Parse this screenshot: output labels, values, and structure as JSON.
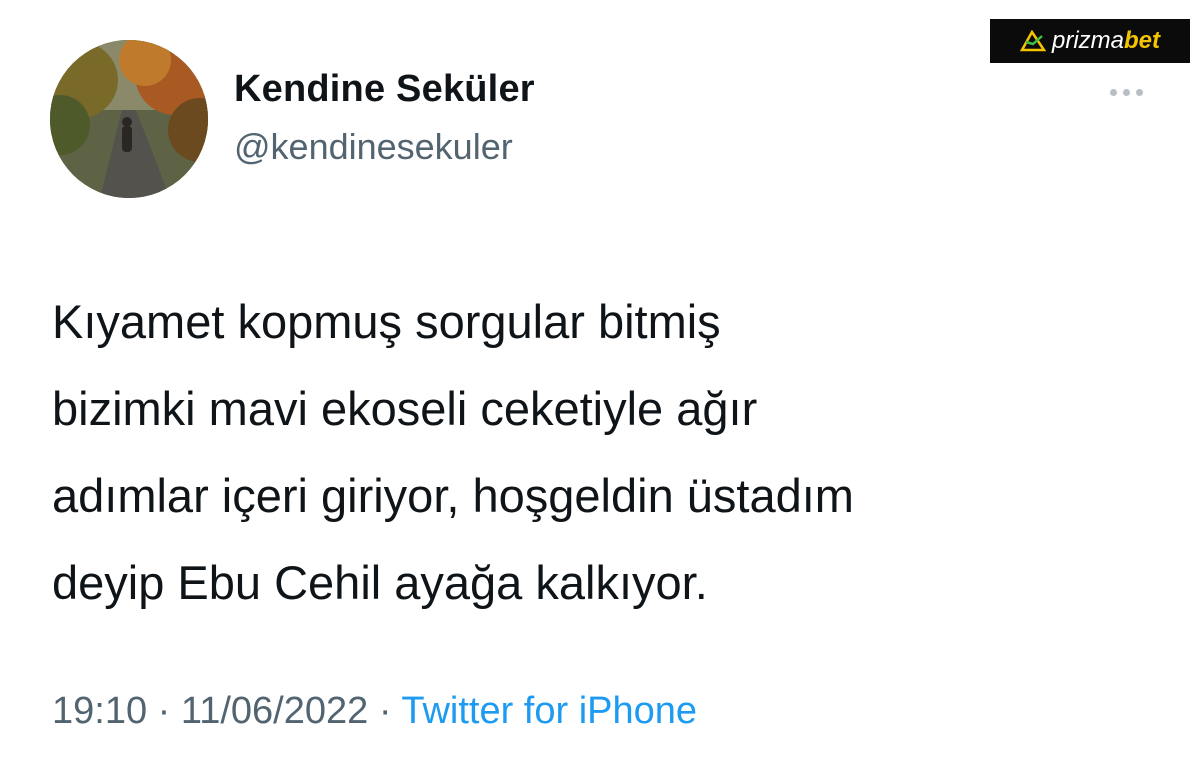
{
  "tweet": {
    "author": {
      "display_name": "Kendine Seküler",
      "handle": "@kendinesekuler"
    },
    "text_lines": [
      "Kıyamet kopmuş sorgular bitmiş",
      "bizimki mavi ekoseli ceketiyle ağır",
      "adımlar içeri giriyor, hoşgeldin üstadım",
      "deyip Ebu Cehil ayağa kalkıyor."
    ],
    "time": "19:10",
    "date": "11/06/2022",
    "separator": "·",
    "source": "Twitter for iPhone"
  },
  "watermark": {
    "text_main": "prizma",
    "text_accent": "bet",
    "accent_color": "#f5c400",
    "icon": "prizmabet-logo-icon"
  },
  "more_menu": {
    "icon": "more-dots-icon"
  },
  "colors": {
    "primary_text": "#0f1419",
    "secondary_text": "#536471",
    "link": "#1d9bf0"
  }
}
